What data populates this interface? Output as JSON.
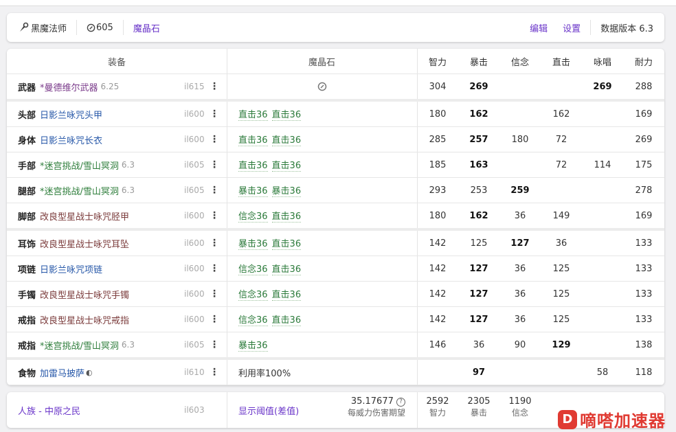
{
  "header": {
    "job": "黑魔法师",
    "item_level": "605",
    "materia_tab": "魔晶石",
    "edit": "编辑",
    "settings": "设置",
    "data_version": "数据版本 6.3"
  },
  "columns": {
    "gear": "装备",
    "materia": "魔晶石",
    "stats": [
      "智力",
      "暴击",
      "信念",
      "直击",
      "咏唱",
      "耐力"
    ]
  },
  "rows": [
    {
      "slot": "武器",
      "name": "*曼德维尔武器",
      "ver": "6.25",
      "il": "il615",
      "kind": "weap",
      "materia": [],
      "stats": [
        "304",
        "269",
        "",
        "",
        "269",
        "288"
      ],
      "bold": [
        1,
        4
      ]
    },
    {
      "slot": "头部",
      "name": "日影兰咏咒头甲",
      "ver": "",
      "il": "il600",
      "kind": "raid",
      "materia": [
        "直击36",
        "直击36"
      ],
      "stats": [
        "180",
        "162",
        "",
        "162",
        "",
        "169"
      ],
      "bold": [
        1
      ]
    },
    {
      "slot": "身体",
      "name": "日影兰咏咒长衣",
      "ver": "",
      "il": "il600",
      "kind": "raid",
      "materia": [
        "直击36",
        "直击36"
      ],
      "stats": [
        "285",
        "257",
        "180",
        "72",
        "",
        "269"
      ],
      "bold": [
        1
      ]
    },
    {
      "slot": "手部",
      "name": "*迷宫挑战/雪山冥洞",
      "ver": "6.3",
      "il": "il605",
      "kind": "pvp",
      "materia": [
        "直击36",
        "直击36"
      ],
      "stats": [
        "185",
        "163",
        "",
        "72",
        "114",
        "175"
      ],
      "bold": [
        1
      ]
    },
    {
      "slot": "腿部",
      "name": "*迷宫挑战/雪山冥洞",
      "ver": "6.3",
      "il": "il605",
      "kind": "pvp",
      "materia": [
        "暴击36",
        "暴击36"
      ],
      "stats": [
        "293",
        "253",
        "259",
        "",
        "",
        "278"
      ],
      "bold": [
        2
      ]
    },
    {
      "slot": "脚部",
      "name": "改良型星战士咏咒胫甲",
      "ver": "",
      "il": "il600",
      "kind": "craft",
      "materia": [
        "信念36",
        "直击36"
      ],
      "stats": [
        "180",
        "162",
        "36",
        "149",
        "",
        "169"
      ],
      "bold": [
        1
      ]
    },
    {
      "slot": "耳饰",
      "name": "改良型星战士咏咒耳坠",
      "ver": "",
      "il": "il600",
      "kind": "craft",
      "materia": [
        "暴击36",
        "直击36"
      ],
      "stats": [
        "142",
        "125",
        "127",
        "36",
        "",
        "133"
      ],
      "bold": [
        2
      ]
    },
    {
      "slot": "项链",
      "name": "日影兰咏咒项链",
      "ver": "",
      "il": "il600",
      "kind": "raid",
      "materia": [
        "信念36",
        "直击36"
      ],
      "stats": [
        "142",
        "127",
        "36",
        "125",
        "",
        "133"
      ],
      "bold": [
        1
      ]
    },
    {
      "slot": "手镯",
      "name": "改良型星战士咏咒手镯",
      "ver": "",
      "il": "il600",
      "kind": "craft",
      "materia": [
        "信念36",
        "直击36"
      ],
      "stats": [
        "142",
        "127",
        "36",
        "125",
        "",
        "133"
      ],
      "bold": [
        1
      ]
    },
    {
      "slot": "戒指",
      "name": "改良型星战士咏咒戒指",
      "ver": "",
      "il": "il600",
      "kind": "craft",
      "materia": [
        "信念36",
        "直击36"
      ],
      "stats": [
        "142",
        "127",
        "36",
        "125",
        "",
        "133"
      ],
      "bold": [
        1
      ]
    },
    {
      "slot": "戒指",
      "name": "*迷宫挑战/雪山冥洞",
      "ver": "6.3",
      "il": "il605",
      "kind": "pvp",
      "materia": [
        "暴击36"
      ],
      "stats": [
        "146",
        "36",
        "90",
        "129",
        "",
        "138"
      ],
      "bold": [
        3
      ]
    },
    {
      "slot": "食物",
      "name": "加雷马披萨",
      "ver": "",
      "il": "il610",
      "kind": "food",
      "materia_text": "利用率100%",
      "materia": [],
      "stats": [
        "",
        "97",
        "",
        "",
        "58",
        "118"
      ],
      "bold": [
        1
      ]
    }
  ],
  "footer": {
    "race": "人族 - 中原之民",
    "il": "il603",
    "threshold": "显示阈值(差值)",
    "damage_value": "35.17677",
    "damage_label": "每威力伤害期望",
    "totals": [
      {
        "value": "2592",
        "label": "智力"
      },
      {
        "value": "2305",
        "label": "暴击"
      },
      {
        "value": "1190",
        "label": "信念"
      }
    ]
  },
  "watermark": {
    "text": "嘀嗒加速器"
  },
  "colors": {
    "accent": "#6a35c9",
    "materia": "#2b7a3a",
    "watermark": "#e03a32"
  }
}
